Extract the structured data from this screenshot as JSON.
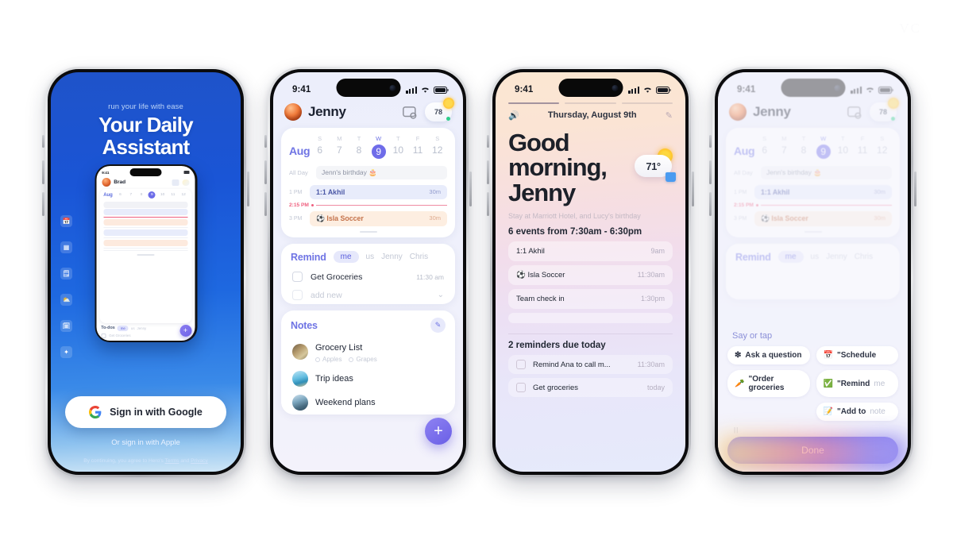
{
  "watermark": "VC",
  "phones": [
    {
      "id": "onboarding",
      "status": {
        "time": "9:41"
      },
      "tagline": "run your life with ease",
      "title_line1": "Your Daily",
      "title_line2": "Assistant",
      "rail_icons": [
        "calendar-icon",
        "dashboard-icon",
        "notes-icon",
        "weather-icon",
        "wallet-icon",
        "sparkle-icon"
      ],
      "google_button": "Sign in with Google",
      "apple_link": "Or sign in with Apple",
      "legal": {
        "prefix": "By continuing, you agree to Hero's ",
        "terms": "Terms",
        "mid": " and ",
        "privacy": "Privacy"
      },
      "mini": {
        "time": "9:41",
        "name": "Brad",
        "month": "Aug",
        "days": [
          "6",
          "7",
          "8",
          "9",
          "10",
          "11",
          "12"
        ],
        "today": "9",
        "todo_label": "To-dos",
        "todo_pill": "me",
        "todo_who": [
          "us",
          "Jenny"
        ],
        "todo_item": "Get Groceries",
        "fab": "+"
      }
    },
    {
      "id": "home",
      "status": {
        "time": "9:41"
      },
      "user": "Jenny",
      "weather_chip": "78",
      "calendar": {
        "month": "Aug",
        "days": [
          {
            "dow": "S",
            "num": "6"
          },
          {
            "dow": "M",
            "num": "7"
          },
          {
            "dow": "T",
            "num": "8"
          },
          {
            "dow": "W",
            "num": "9",
            "today": true
          },
          {
            "dow": "T",
            "num": "10"
          },
          {
            "dow": "F",
            "num": "11"
          },
          {
            "dow": "S",
            "num": "12"
          }
        ],
        "allday_label": "All Day",
        "allday_event": "Jenn's birthday 🎂",
        "rows": [
          {
            "time": "1 PM",
            "title": "1:1 Akhil",
            "dur": "30m",
            "tone": "blue"
          }
        ],
        "now_label": "2:15 PM",
        "rows2": [
          {
            "time": "3 PM",
            "title": "⚽ Isla Soccer",
            "dur": "30m",
            "tone": "or"
          }
        ]
      },
      "remind": {
        "label": "Remind",
        "pill": "me",
        "who": [
          "us",
          "Jenny",
          "Chris"
        ],
        "items": [
          {
            "text": "Get Groceries",
            "time": "11:30 am",
            "ghost": false
          },
          {
            "text": "add new",
            "time": "",
            "ghost": true
          }
        ]
      },
      "notes": {
        "label": "Notes",
        "edit_icon": "edit-icon",
        "items": [
          {
            "title": "Grocery List",
            "sub": [
              "Apples",
              "Grapes"
            ],
            "thumb": "nt1"
          },
          {
            "title": "Trip ideas",
            "sub": [],
            "thumb": "nt2"
          },
          {
            "title": "Weekend plans",
            "sub": [],
            "thumb": "nt3"
          }
        ]
      },
      "fab": "+"
    },
    {
      "id": "briefing",
      "status": {
        "time": "9:41"
      },
      "date": "Thursday, August 9th",
      "speaker_icon": "speaker-icon",
      "edit_icon": "pencil-icon",
      "greeting_l1": "Good",
      "greeting_l2": "morning,",
      "greeting_l3": "Jenny",
      "temperature": "71°",
      "subtitle": "Stay at Marriott Hotel, and Lucy's birthday",
      "events_count": "6 events from 7:30am - 6:30pm",
      "events": [
        {
          "title": "1:1 Akhil",
          "time": "9am"
        },
        {
          "title": "⚽ Isla Soccer",
          "time": "11:30am"
        },
        {
          "title": "Team check in",
          "time": "1:30pm"
        }
      ],
      "reminders_count": "2 reminders due today",
      "reminders": [
        {
          "text": "Remind Ana to call m...",
          "time": "11:30am"
        },
        {
          "text": "Get groceries",
          "time": "today"
        }
      ]
    },
    {
      "id": "voice",
      "status": {
        "time": "9:41"
      },
      "user": "Jenny",
      "weather_chip": "78",
      "say_or_tap": "Say or tap",
      "chips": [
        {
          "glyph": "📅",
          "text": "\"Schedule",
          "muted": ""
        },
        {
          "glyph": "❇",
          "text": "Ask a question",
          "muted": ""
        },
        {
          "glyph": "✅",
          "text": "\"Remind ",
          "muted": "me"
        },
        {
          "glyph": "🥕",
          "text": "\"Order groceries",
          "muted": ""
        },
        {
          "glyph": "📝",
          "text": "\"Add to ",
          "muted": "note"
        }
      ],
      "done_label": "Done"
    }
  ]
}
